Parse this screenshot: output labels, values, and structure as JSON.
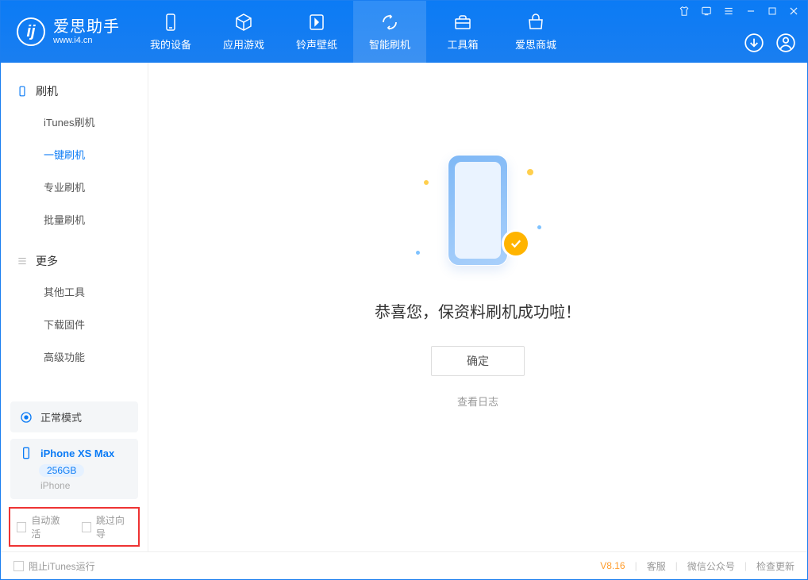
{
  "app": {
    "title": "爱思助手",
    "site": "www.i4.cn"
  },
  "nav": {
    "device": "我的设备",
    "apps": "应用游戏",
    "ring": "铃声壁纸",
    "flash": "智能刷机",
    "tools": "工具箱",
    "store": "爱思商城"
  },
  "sidebar": {
    "flash_section": "刷机",
    "items": {
      "itunes": "iTunes刷机",
      "onekey": "一键刷机",
      "pro": "专业刷机",
      "batch": "批量刷机"
    },
    "more_section": "更多",
    "more_items": {
      "other": "其他工具",
      "firmware": "下载固件",
      "advanced": "高级功能"
    }
  },
  "mode": {
    "label": "正常模式"
  },
  "device": {
    "name": "iPhone XS Max",
    "storage": "256GB",
    "type": "iPhone"
  },
  "options": {
    "auto_activate": "自动激活",
    "skip_guide": "跳过向导"
  },
  "main": {
    "success_msg": "恭喜您，保资料刷机成功啦！",
    "ok": "确定",
    "view_log": "查看日志"
  },
  "footer": {
    "block_itunes": "阻止iTunes运行",
    "version": "V8.16",
    "support": "客服",
    "wechat": "微信公众号",
    "update": "检查更新"
  }
}
